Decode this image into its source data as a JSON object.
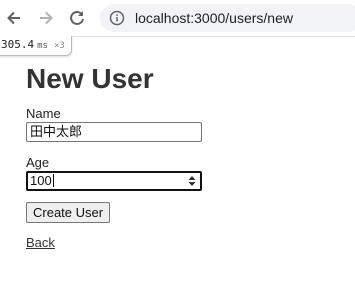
{
  "browser": {
    "url": "localhost:3000/users/new",
    "icons": {
      "back": "back-arrow-icon",
      "forward": "forward-arrow-icon",
      "reload": "reload-icon",
      "site_info": "info-icon"
    }
  },
  "profiler": {
    "time": "305.4",
    "unit": "ms",
    "count": "×3"
  },
  "page": {
    "title": "New User",
    "form": {
      "name_label": "Name",
      "name_value": "田中太郎",
      "age_label": "Age",
      "age_value": "100",
      "submit_label": "Create User"
    },
    "back_link": "Back"
  }
}
